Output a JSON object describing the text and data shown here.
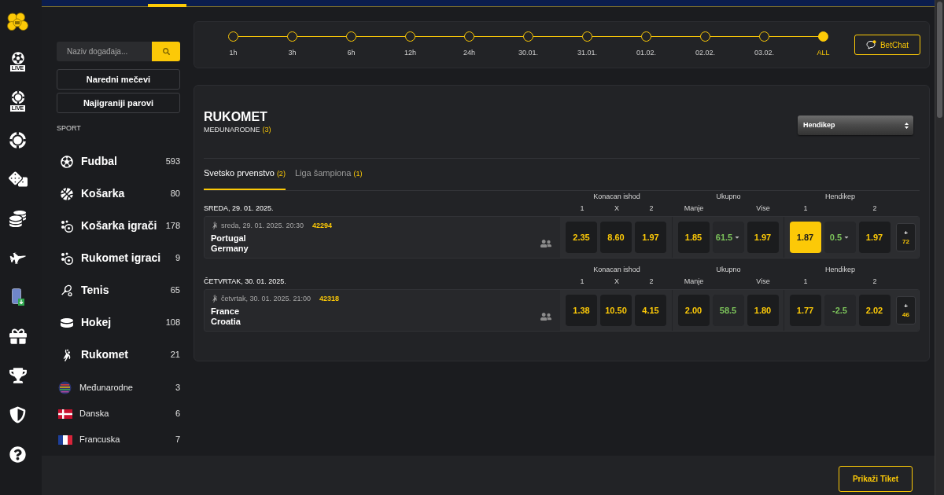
{
  "nav_rail": [
    {
      "kind": "logo"
    },
    {
      "kind": "football",
      "badge": "LIVE"
    },
    {
      "kind": "casino",
      "badge": "LIVE"
    },
    {
      "kind": "chip"
    },
    {
      "kind": "dice"
    },
    {
      "kind": "chips"
    },
    {
      "kind": "plane"
    },
    {
      "kind": "phone"
    },
    {
      "kind": "gift"
    },
    {
      "kind": "trophy"
    },
    {
      "kind": "shield"
    },
    {
      "kind": "help"
    }
  ],
  "sidebar": {
    "search": {
      "placeholder": "Naziv događaja..."
    },
    "buttons": [
      "Naredni mečevi",
      "Najigraniji parovi"
    ],
    "section_label": "SPORT",
    "sports": [
      {
        "kind": "football",
        "name": "Fudbal",
        "count": "593"
      },
      {
        "kind": "basketball",
        "name": "Košarka",
        "count": "80"
      },
      {
        "kind": "basketball-players",
        "name": "Košarka igrači",
        "count": "178"
      },
      {
        "kind": "handball-players",
        "name": "Rukomet igraci",
        "count": "9"
      },
      {
        "kind": "tennis",
        "name": "Tenis",
        "count": "65"
      },
      {
        "kind": "hockey",
        "name": "Hokej",
        "count": "108"
      },
      {
        "kind": "handball",
        "name": "Rukomet",
        "count": "21",
        "children": [
          {
            "kind": "globe",
            "name": "Međunarodne",
            "count": "3"
          },
          {
            "kind": "flag-dk",
            "name": "Danska",
            "count": "6"
          },
          {
            "kind": "flag-fr",
            "name": "Francuska",
            "count": "7"
          }
        ]
      }
    ]
  },
  "timeline": {
    "stops": [
      {
        "label": "1h",
        "selected": false
      },
      {
        "label": "3h",
        "selected": false
      },
      {
        "label": "6h",
        "selected": false
      },
      {
        "label": "12h",
        "selected": false
      },
      {
        "label": "24h",
        "selected": false
      },
      {
        "label": "30.01.",
        "selected": false
      },
      {
        "label": "31.01.",
        "selected": false
      },
      {
        "label": "01.02.",
        "selected": false
      },
      {
        "label": "02.02.",
        "selected": false
      },
      {
        "label": "03.02.",
        "selected": false
      },
      {
        "label": "ALL",
        "selected": true
      }
    ],
    "chat_button": {
      "label": "BetChat"
    }
  },
  "league": {
    "sport": "RUKOMET",
    "category": "MEĐUNARODNE",
    "count": "(3)",
    "market_select": {
      "value": "Hendikep"
    },
    "tabs": [
      {
        "label": "Svetsko prvenstvo",
        "count": "(2)",
        "selected": true
      },
      {
        "label": "Liga šampiona",
        "count": "(1)",
        "selected": false
      }
    ],
    "days": [
      {
        "date": "SREDA, 29. 01. 2025.",
        "markets": [
          {
            "title": "Konacan ishod",
            "headers": [
              "1",
              "X",
              "2"
            ]
          },
          {
            "title": "Ukupno",
            "headers": [
              "Manje",
              "Vise"
            ]
          },
          {
            "title": "Hendikep",
            "headers": [
              "1",
              "2"
            ]
          }
        ],
        "matches": [
          {
            "time": "sreda, 29. 01. 2025. 20:30",
            "code": "42294",
            "home": "Portugal",
            "away": "Germany",
            "odds": [
              [
                {
                  "kind": "odd",
                  "value": "2.35",
                  "selected": false
                },
                {
                  "kind": "odd",
                  "value": "8.60",
                  "selected": false
                },
                {
                  "kind": "odd",
                  "value": "1.97",
                  "selected": false
                }
              ],
              [
                {
                  "kind": "odd",
                  "value": "1.85",
                  "selected": false
                },
                {
                  "kind": "line",
                  "value": "61.5",
                  "dropdown": true
                },
                {
                  "kind": "odd",
                  "value": "1.97",
                  "selected": false
                }
              ],
              [
                {
                  "kind": "odd",
                  "value": "1.87",
                  "selected": true
                },
                {
                  "kind": "line",
                  "value": "0.5",
                  "dropdown": true
                },
                {
                  "kind": "odd",
                  "value": "1.97",
                  "selected": false
                }
              ]
            ],
            "more": {
              "sign": "+",
              "count": "72"
            }
          }
        ]
      },
      {
        "date": "ČETVRTAK, 30. 01. 2025.",
        "markets": [
          {
            "title": "Konacan ishod",
            "headers": [
              "1",
              "X",
              "2"
            ]
          },
          {
            "title": "Ukupno",
            "headers": [
              "Manje",
              "Vise"
            ]
          },
          {
            "title": "Hendikep",
            "headers": [
              "1",
              "2"
            ]
          }
        ],
        "matches": [
          {
            "time": "četvrtak, 30. 01. 2025. 21:00",
            "code": "42318",
            "home": "France",
            "away": "Croatia",
            "odds": [
              [
                {
                  "kind": "odd",
                  "value": "1.38",
                  "selected": false
                },
                {
                  "kind": "odd",
                  "value": "10.50",
                  "selected": false
                },
                {
                  "kind": "odd",
                  "value": "4.15",
                  "selected": false
                }
              ],
              [
                {
                  "kind": "odd",
                  "value": "2.00",
                  "selected": false
                },
                {
                  "kind": "line",
                  "value": "58.5",
                  "dropdown": false
                },
                {
                  "kind": "odd",
                  "value": "1.80",
                  "selected": false
                }
              ],
              [
                {
                  "kind": "odd",
                  "value": "1.77",
                  "selected": false
                },
                {
                  "kind": "line",
                  "value": "-2.5",
                  "dropdown": false
                },
                {
                  "kind": "odd",
                  "value": "2.02",
                  "selected": false
                }
              ]
            ],
            "more": {
              "sign": "+",
              "count": "46"
            }
          }
        ]
      }
    ]
  },
  "ticket_button": {
    "label": "Prikaži Tiket"
  }
}
